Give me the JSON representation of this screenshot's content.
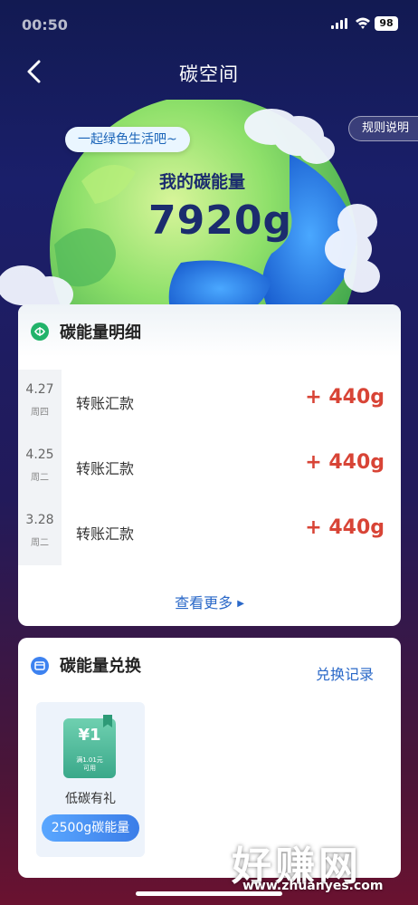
{
  "status_bar": {
    "time": "00:50",
    "battery": "98"
  },
  "nav": {
    "title": "碳空间"
  },
  "hero": {
    "rules_label": "规则说明",
    "slogan": "一起绿色生活吧~",
    "energy_label": "我的碳能量",
    "energy_value": "7920g"
  },
  "detail": {
    "title": "碳能量明细",
    "records": [
      {
        "day": "4.27",
        "weekday": "周四",
        "desc": "转账汇款",
        "amount": "+ 440g"
      },
      {
        "day": "4.25",
        "weekday": "周二",
        "desc": "转账汇款",
        "amount": "+ 440g"
      },
      {
        "day": "3.28",
        "weekday": "周二",
        "desc": "转账汇款",
        "amount": "+ 440g"
      }
    ],
    "more_label": "查看更多"
  },
  "exchange": {
    "title": "碳能量兑换",
    "history_label": "兑换记录",
    "items": [
      {
        "coupon_amount": "¥1",
        "coupon_note_1": "满1.01元",
        "coupon_note_2": "可用",
        "name": "低碳有礼",
        "cost": "2500g碳能量"
      }
    ]
  },
  "watermark": {
    "brand": "好赚网",
    "url": "www.zhuanyes.com"
  },
  "colors": {
    "accent_blue": "#2a68c8",
    "amount_red": "#d84436",
    "bg_navy": "#1a1f6a"
  }
}
